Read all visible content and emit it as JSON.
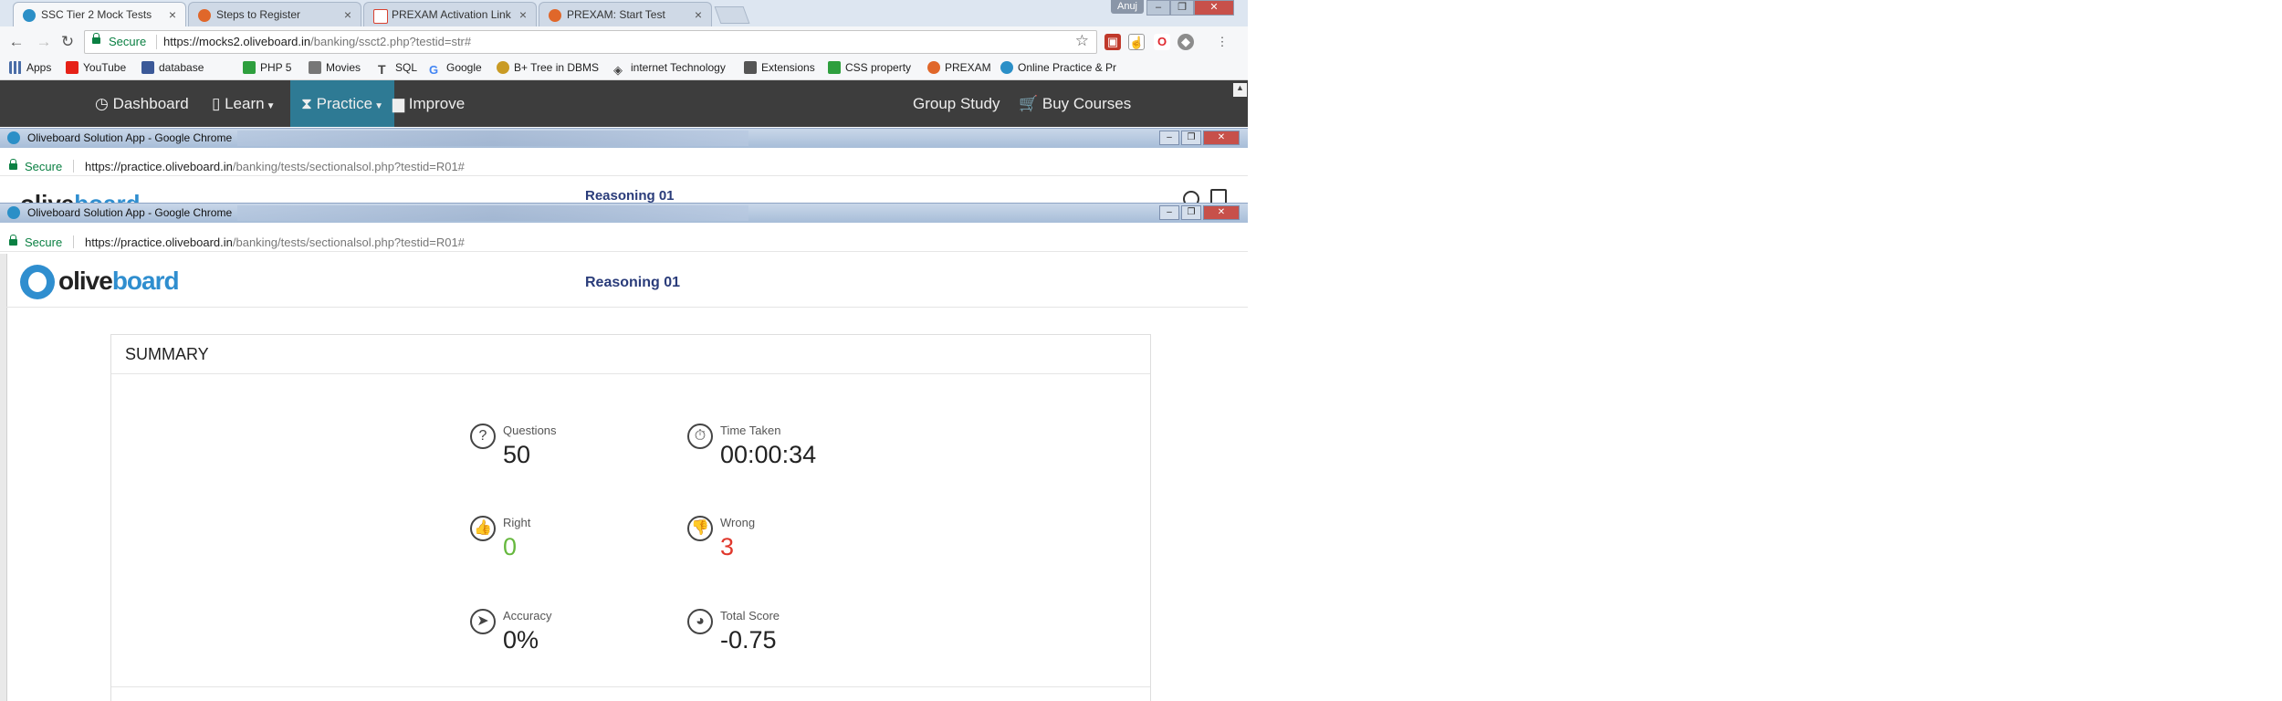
{
  "browser": {
    "tabs": [
      {
        "title": "SSC Tier 2 Mock Tests",
        "icon": "oliveboard-icon",
        "color": "#2b8fc7"
      },
      {
        "title": "Steps to Register",
        "icon": "prexam-icon",
        "color": "#e0672a"
      },
      {
        "title": "PREXAM Activation Link",
        "icon": "gmail-icon",
        "color": "#d9412f"
      },
      {
        "title": "PREXAM: Start Test",
        "icon": "prexam-icon",
        "color": "#e0672a"
      }
    ],
    "user_badge": "Anuj",
    "secure_label": "Secure",
    "url_host": "https://mocks2.oliveboard.in",
    "url_path": "/banking/ssct2.php?testid=str#",
    "bookmarks": [
      {
        "label": "Apps",
        "icon": "apps-grid-icon",
        "color": "#4a6da7"
      },
      {
        "label": "YouTube",
        "icon": "youtube-icon",
        "color": "#e62117"
      },
      {
        "label": "database",
        "icon": "facebook-icon",
        "color": "#3b5998"
      },
      {
        "label": "PHP 5",
        "icon": "php-icon",
        "color": "#2e9f3e"
      },
      {
        "label": "Movies",
        "icon": "movies-icon",
        "color": "#555555"
      },
      {
        "label": "SQL",
        "icon": "sql-icon",
        "color": "#555555"
      },
      {
        "label": "Google",
        "icon": "google-icon",
        "color": "#4285f4"
      },
      {
        "label": "B+ Tree in DBMS",
        "icon": "tree-icon",
        "color": "#c99b25"
      },
      {
        "label": "internet Technology",
        "icon": "diamond-icon",
        "color": "#444444"
      },
      {
        "label": "Extensions",
        "icon": "puzzle-icon",
        "color": "#444444"
      },
      {
        "label": "CSS property",
        "icon": "css-icon",
        "color": "#2e9f3e"
      },
      {
        "label": "PREXAM",
        "icon": "prexam-icon",
        "color": "#e0672a"
      },
      {
        "label": "Online Practice & Pr",
        "icon": "oliveboard-icon",
        "color": "#2b8fc7"
      }
    ]
  },
  "site_nav": {
    "dashboard": "Dashboard",
    "learn": "Learn",
    "practice": "Practice",
    "improve": "Improve",
    "group_study": "Group Study",
    "buy_courses": "Buy Courses"
  },
  "popup": {
    "window_title": "Oliveboard Solution App - Google Chrome",
    "secure_label": "Secure",
    "url_host": "https://practice.oliveboard.in",
    "url_path": "/banking/tests/sectionalsol.php?testid=R01#",
    "logo_part1": "olive",
    "logo_part2": "board",
    "test_title": "Reasoning 01",
    "cut_test_title": "Reasoning 01"
  },
  "summary": {
    "title": "SUMMARY",
    "stats": [
      {
        "label": "Questions",
        "value": "50",
        "icon": "question-icon",
        "tone": "neutral"
      },
      {
        "label": "Time Taken",
        "value": "00:00:34",
        "icon": "stopwatch-icon",
        "tone": "neutral"
      },
      {
        "label": "Right",
        "value": "0",
        "icon": "thumbs-up-icon",
        "tone": "green"
      },
      {
        "label": "Wrong",
        "value": "3",
        "icon": "thumbs-down-icon",
        "tone": "red"
      },
      {
        "label": "Accuracy",
        "value": "0%",
        "icon": "paper-plane-icon",
        "tone": "neutral"
      },
      {
        "label": "Total Score",
        "value": "-0.75",
        "icon": "score-icon",
        "tone": "neutral"
      }
    ]
  },
  "colors": {
    "nav_bg": "#3d3d3d",
    "nav_active": "#2e7a94",
    "brand_blue": "#2f8ecf",
    "title_navy": "#2a3c7a",
    "right_green": "#66b83e",
    "wrong_red": "#e0382c"
  }
}
